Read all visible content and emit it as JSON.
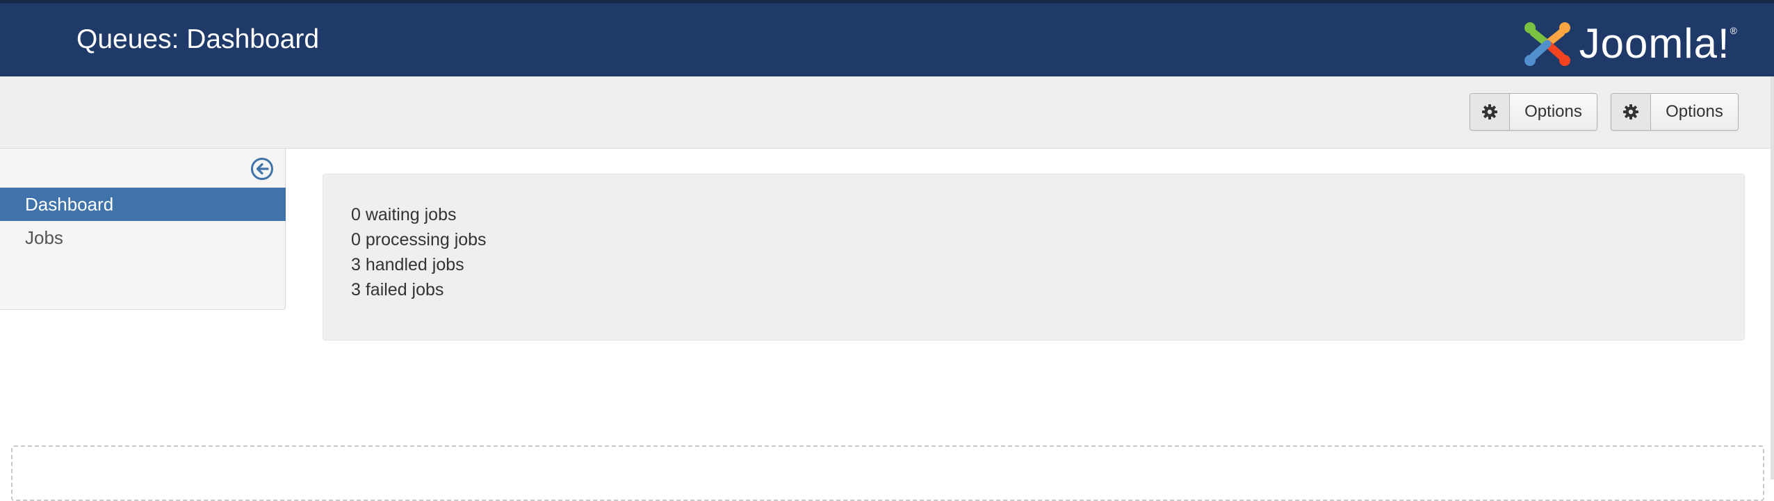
{
  "header": {
    "title": "Queues: Dashboard",
    "logo_text": "Joomla!",
    "logo_mark": "®",
    "logo_icon": "joomla-logo-icon",
    "background_color": "#1f3a68"
  },
  "toolbar": {
    "buttons": [
      {
        "label": "Options",
        "icon": "gear-icon"
      },
      {
        "label": "Options",
        "icon": "gear-icon"
      }
    ]
  },
  "sidebar": {
    "collapse_icon": "arrow-left-circle-icon",
    "items": [
      {
        "label": "Dashboard",
        "active": true
      },
      {
        "label": "Jobs",
        "active": false
      }
    ],
    "active_color": "#3f73a9"
  },
  "stats": {
    "waiting": "0 waiting jobs",
    "processing": "0 processing jobs",
    "handled": "3 handled jobs",
    "failed": "3 failed jobs"
  }
}
